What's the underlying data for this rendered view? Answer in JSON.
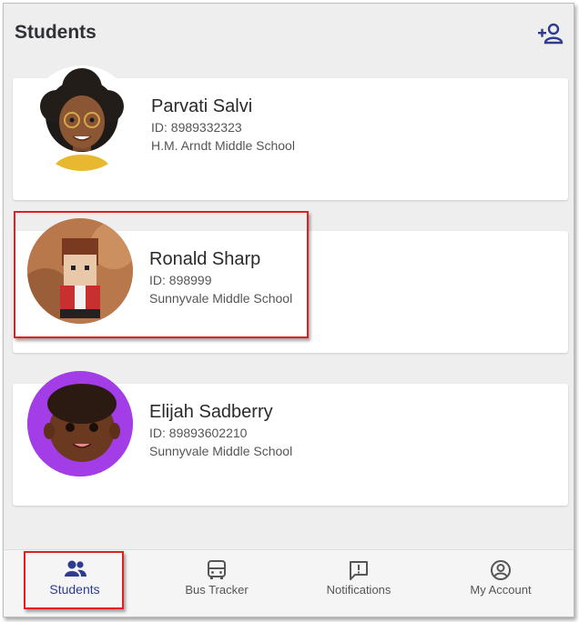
{
  "header": {
    "title": "Students",
    "add_icon": "person-add-icon"
  },
  "students": [
    {
      "name": "Parvati Salvi",
      "id": "ID: 8989332323",
      "school": "H.M. Arndt Middle School",
      "avatar": "cartoon-girl-avatar"
    },
    {
      "name": "Ronald Sharp",
      "id": "ID: 898999",
      "school": "Sunnyvale Middle School",
      "avatar": "brick-figure-avatar"
    },
    {
      "name": "Elijah Sadberry",
      "id": "ID: 89893602210",
      "school": "Sunnyvale Middle School",
      "avatar": "cartoon-boy-avatar"
    }
  ],
  "nav": {
    "items": [
      {
        "label": "Students",
        "icon": "people-icon"
      },
      {
        "label": "Bus Tracker",
        "icon": "bus-icon"
      },
      {
        "label": "Notifications",
        "icon": "notification-icon"
      },
      {
        "label": "My Account",
        "icon": "account-circle-icon"
      }
    ],
    "active": "Students"
  },
  "colors": {
    "accent": "#2e3b8e",
    "highlight": "#e02020",
    "background": "#eeeeee"
  }
}
